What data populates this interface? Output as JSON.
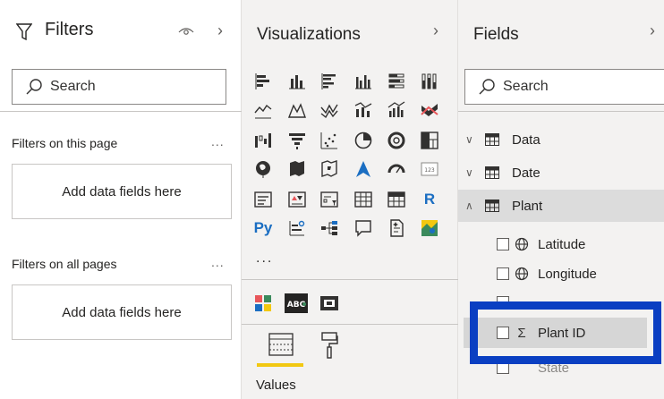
{
  "filters": {
    "title": "Filters",
    "search_placeholder": "Search",
    "on_this_page_label": "Filters on this page",
    "on_all_pages_label": "Filters on all pages",
    "ellipsis": "...",
    "dropzone_text": "Add data fields here"
  },
  "visualizations": {
    "title": "Visualizations",
    "python_label": "Py",
    "r_label": "R",
    "more": "...",
    "values_label": "Values"
  },
  "fields": {
    "title": "Fields",
    "search_placeholder": "Search",
    "tables": [
      {
        "name": "Data",
        "expanded": false
      },
      {
        "name": "Date",
        "expanded": false
      },
      {
        "name": "Plant",
        "expanded": true
      }
    ],
    "plant_fields": [
      {
        "name": "Latitude",
        "icon": "globe-icon"
      },
      {
        "name": "Longitude",
        "icon": "globe-icon"
      },
      {
        "name": "Plant ID",
        "icon": "sigma-icon"
      },
      {
        "name": "State",
        "icon": "none"
      }
    ]
  },
  "colors": {
    "highlight": "#0a3fc2",
    "accent": "#f2c811"
  }
}
